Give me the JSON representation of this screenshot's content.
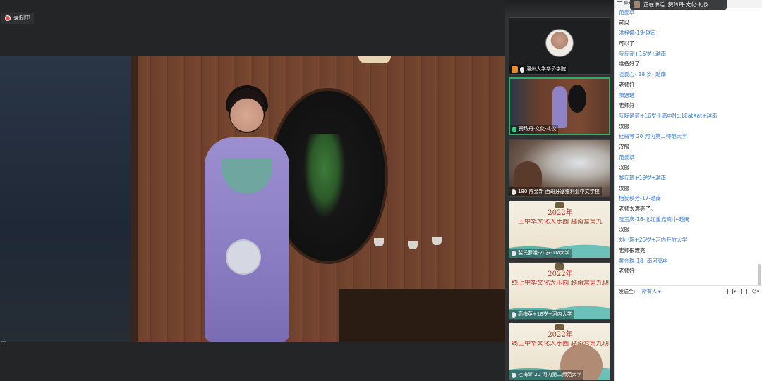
{
  "recording": {
    "label": "录制中"
  },
  "speaking": {
    "prefix": "正在讲话:",
    "name": "僰玲丹·文化·礼仪"
  },
  "chat_header": {
    "title": "聊天"
  },
  "thumbnails": [
    {
      "label": "温州大学华侨学院",
      "kind": "avatar"
    },
    {
      "label": "僰玲丹·文化·礼仪",
      "kind": "video",
      "active": true
    },
    {
      "label": "180 陈金新 西班牙塞维利亚中文学校",
      "kind": "video"
    },
    {
      "label": "裴氏萝娥-20岁-TM大学",
      "kind": "banner",
      "year": "2022年",
      "text": "上中华文化大乐园  越南营第九"
    },
    {
      "label": "高梅英+18岁+河内大学",
      "kind": "banner",
      "year": "2022年",
      "text": "线上中华文化大乐园  越南营第九期"
    },
    {
      "label": "杜梅琴 20 河内第二师范大学",
      "kind": "banner",
      "year": "2022年",
      "text": "线上中华文化大乐园  越南营第九期"
    }
  ],
  "chat": [
    {
      "type": "sender",
      "text": "范氏草"
    },
    {
      "type": "msg",
      "text": "可以"
    },
    {
      "type": "sender",
      "text": "洪梓娜-19-越南"
    },
    {
      "type": "msg",
      "text": "可以了"
    },
    {
      "type": "sender",
      "text": "阮氏商+16岁+越南"
    },
    {
      "type": "msg",
      "text": "准备好了"
    },
    {
      "type": "sender",
      "text": "凌氏心- 18 岁- 越南"
    },
    {
      "type": "msg",
      "text": "老师好"
    },
    {
      "type": "sender",
      "text": "陳邁璉"
    },
    {
      "type": "msg",
      "text": "老师好"
    },
    {
      "type": "sender",
      "text": "阮陈楚蓝+16岁十高中No.18atXat+越南"
    },
    {
      "type": "msg",
      "text": "汉服"
    },
    {
      "type": "sender",
      "text": "杜梅琴 20 河内第二师范大学"
    },
    {
      "type": "msg",
      "text": "汉服"
    },
    {
      "type": "sender",
      "text": "范氏草"
    },
    {
      "type": "msg",
      "text": "汉服"
    },
    {
      "type": "sender",
      "text": "黎氏琼+19岁+越南"
    },
    {
      "type": "msg",
      "text": "汉服"
    },
    {
      "type": "sender",
      "text": "杨氏秋芳-17-越南"
    },
    {
      "type": "msg",
      "text": "老师太漂亮了。"
    },
    {
      "type": "sender",
      "text": "阮玉庆-16-北江重点高中-越南"
    },
    {
      "type": "msg",
      "text": "汉服"
    },
    {
      "type": "sender",
      "text": "刘小琪+25岁+河内开放大学"
    },
    {
      "type": "msg",
      "text": "老师很漂亮"
    },
    {
      "type": "sender",
      "text": "黄金珠-18- 南河高中"
    },
    {
      "type": "msg",
      "text": "老师好"
    }
  ],
  "footer": {
    "send_to_label": "发送至:",
    "send_to_value": "所有人"
  },
  "colors": {
    "sender": "#3a7bd5",
    "active_border": "#2fae64",
    "banner_red": "#c2372c"
  },
  "icons": [
    "record-icon",
    "menu-icon",
    "mic-icon",
    "avatar-icon",
    "chat-icon",
    "file-icon",
    "screenshot-icon",
    "user-icon"
  ]
}
